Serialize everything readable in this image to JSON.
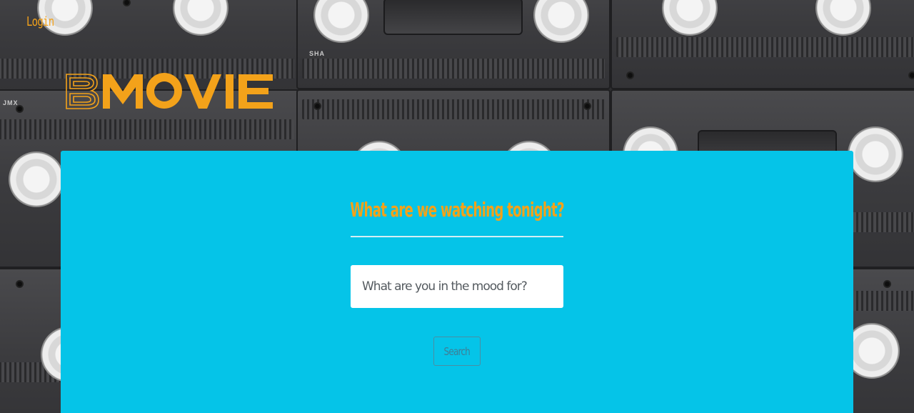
{
  "header": {
    "login_label": "Login",
    "logo_text": "BMOVIE"
  },
  "background": {
    "tape_labels": [
      "SHA",
      "JMX"
    ]
  },
  "main": {
    "headline": "What are we watching tonight?",
    "search": {
      "placeholder": "What are you in the mood for?",
      "value": ""
    },
    "search_button_label": "Search"
  },
  "colors": {
    "accent": "#f3a21a",
    "panel": "#05c4e8",
    "button_text": "#3e7e96"
  }
}
